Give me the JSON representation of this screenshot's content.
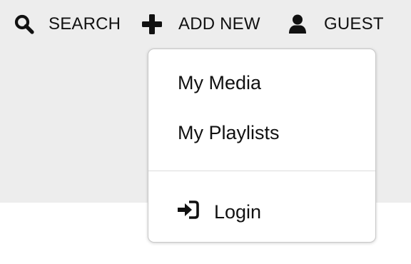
{
  "nav": {
    "search": {
      "label": "SEARCH",
      "icon": "search-icon"
    },
    "add_new": {
      "label": "ADD NEW",
      "icon": "plus-icon"
    },
    "guest": {
      "label": "GUEST",
      "icon": "user-icon"
    }
  },
  "dropdown": {
    "items": [
      {
        "label": "My Media"
      },
      {
        "label": "My Playlists"
      }
    ],
    "login": {
      "label": "Login",
      "icon": "sign-in-icon"
    }
  },
  "colors": {
    "header_background": "#ededed",
    "text": "#111111",
    "dropdown_border": "#c8c8c8"
  }
}
